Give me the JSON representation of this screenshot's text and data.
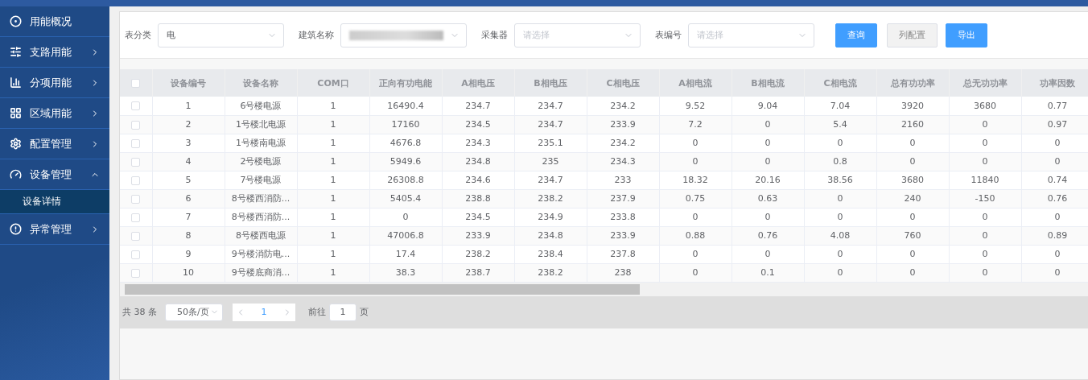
{
  "sidebar": {
    "items": [
      {
        "label": "用能概况",
        "has_arrow": false,
        "expanded": false
      },
      {
        "label": "支路用能",
        "has_arrow": true,
        "expanded": false
      },
      {
        "label": "分项用能",
        "has_arrow": true,
        "expanded": false
      },
      {
        "label": "区域用能",
        "has_arrow": true,
        "expanded": false
      },
      {
        "label": "配置管理",
        "has_arrow": true,
        "expanded": false
      },
      {
        "label": "设备管理",
        "has_arrow": true,
        "expanded": true,
        "children": [
          {
            "label": "设备详情",
            "selected": true
          }
        ]
      },
      {
        "label": "异常管理",
        "has_arrow": true,
        "expanded": false
      }
    ]
  },
  "filters": [
    {
      "label": "表分类",
      "value": "电"
    },
    {
      "label": "建筑名称",
      "blurred": true
    },
    {
      "label": "采集器",
      "placeholder": "请选择"
    },
    {
      "label": "表编号",
      "placeholder": "请选择"
    }
  ],
  "buttons": [
    {
      "label": "查询",
      "kind": "primary"
    },
    {
      "label": "列配置",
      "kind": "default"
    },
    {
      "label": "导出",
      "kind": "primary"
    }
  ],
  "table": {
    "all_checked": false,
    "columns": [
      "设备编号",
      "设备名称",
      "COM口",
      "正向有功电能",
      "A相电压",
      "B相电压",
      "C相电压",
      "A相电流",
      "B相电流",
      "C相电流",
      "总有功功率",
      "总无功功率",
      "功率因数"
    ],
    "rows": [
      {
        "checked": false,
        "cells": [
          "1",
          "6号楼电源",
          "1",
          "16490.4",
          "234.7",
          "234.7",
          "234.2",
          "9.52",
          "9.04",
          "7.04",
          "3920",
          "3680",
          "0.77"
        ]
      },
      {
        "checked": false,
        "cells": [
          "2",
          "1号楼北电源",
          "1",
          "17160",
          "234.5",
          "234.7",
          "233.9",
          "7.2",
          "0",
          "5.4",
          "2160",
          "0",
          "0.97"
        ]
      },
      {
        "checked": false,
        "cells": [
          "3",
          "1号楼南电源",
          "1",
          "4676.8",
          "234.3",
          "235.1",
          "234.2",
          "0",
          "0",
          "0",
          "0",
          "0",
          "0"
        ]
      },
      {
        "checked": false,
        "cells": [
          "4",
          "2号楼电源",
          "1",
          "5949.6",
          "234.8",
          "235",
          "234.3",
          "0",
          "0",
          "0.8",
          "0",
          "0",
          "0"
        ]
      },
      {
        "checked": false,
        "cells": [
          "5",
          "7号楼电源",
          "1",
          "26308.8",
          "234.6",
          "234.7",
          "233",
          "18.32",
          "20.16",
          "38.56",
          "3680",
          "11840",
          "0.74"
        ]
      },
      {
        "checked": false,
        "cells": [
          "6",
          "8号楼西消防...",
          "1",
          "5405.4",
          "238.8",
          "238.2",
          "237.9",
          "0.75",
          "0.63",
          "0",
          "240",
          "-150",
          "0.76"
        ]
      },
      {
        "checked": false,
        "cells": [
          "7",
          "8号楼西消防...",
          "1",
          "0",
          "234.5",
          "234.9",
          "233.8",
          "0",
          "0",
          "0",
          "0",
          "0",
          "0"
        ]
      },
      {
        "checked": false,
        "cells": [
          "8",
          "8号楼西电源",
          "1",
          "47006.8",
          "233.9",
          "234.8",
          "233.9",
          "0.88",
          "0.76",
          "4.08",
          "760",
          "0",
          "0.89"
        ]
      },
      {
        "checked": false,
        "cells": [
          "9",
          "9号楼消防电...",
          "1",
          "17.4",
          "238.2",
          "238.4",
          "237.8",
          "0",
          "0",
          "0",
          "0",
          "0",
          "0"
        ]
      },
      {
        "checked": false,
        "cells": [
          "10",
          "9号楼底商消...",
          "1",
          "38.3",
          "238.7",
          "238.2",
          "238",
          "0",
          "0.1",
          "0",
          "0",
          "0",
          "0"
        ]
      }
    ]
  },
  "pagination": {
    "total": "共 38 条",
    "page_size": "50条/页",
    "pages": [
      {
        "label": "1",
        "selected": true
      }
    ],
    "goto_label": "前往",
    "goto_value": "1",
    "page_unit": "页"
  }
}
